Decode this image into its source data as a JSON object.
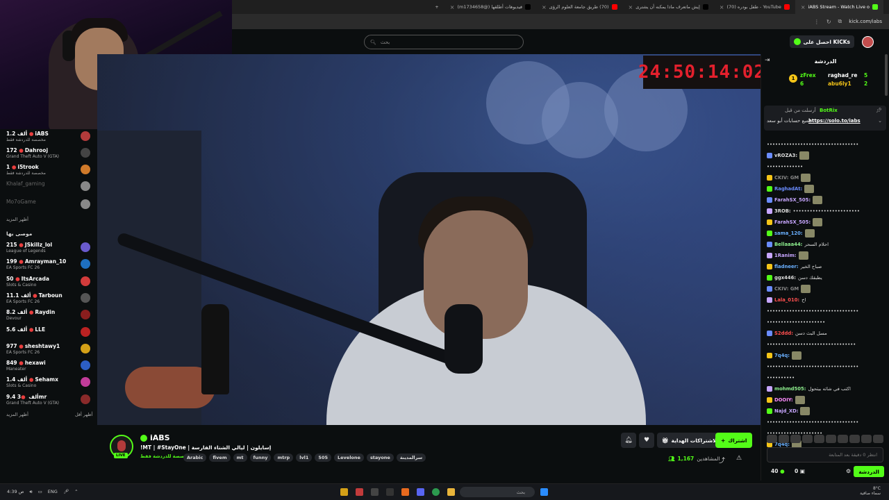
{
  "browser": {
    "tabs": [
      {
        "label": "iABS Stream - Watch Live o",
        "color": "#53fc18",
        "active": true
      },
      {
        "label": "YouTube - طفل بودره (70)",
        "color": "#ff0000",
        "active": false
      },
      {
        "label": "إيش ماتعرف ماذا يمكنه أن يشترى",
        "color": "#000000",
        "active": false
      },
      {
        "label": "(70) طريق جامعة العلوم الرؤى",
        "color": "#ff0000",
        "active": false
      },
      {
        "label": "فيديوهات أطلقها (@m1734658)",
        "color": "#000000",
        "active": false
      }
    ],
    "url": "kick.com/iabs"
  },
  "topnav": {
    "search_placeholder": "بحث",
    "get_kicks": "احصل على KICKs"
  },
  "sidebar": {
    "following": [
      {
        "name": "iABS",
        "viewers": "1.2 ألف",
        "sub": "مخصصة للدردشة فقط",
        "color": "#b23b3b"
      },
      {
        "name": "Dahrooj",
        "viewers": "172",
        "sub": "Grand Theft Auto V (GTA)",
        "color": "#444"
      },
      {
        "name": "i5trook",
        "viewers": "1",
        "sub": "مخصصة للدردشة فقط",
        "color": "#d07a2a"
      },
      {
        "name": "Khalaf_gaming",
        "viewers": "",
        "sub": "",
        "color": "#888"
      },
      {
        "name": "Mo7oGame",
        "viewers": "",
        "sub": "",
        "color": "#888"
      }
    ],
    "show_more_1": "أظهر المزيد",
    "recommended_title": "موصى بها",
    "recommended": [
      {
        "name": "JSkillz_lol",
        "viewers": "215",
        "sub": "League of Legends",
        "color": "#6a5acd"
      },
      {
        "name": "Amrayman_10",
        "viewers": "199",
        "sub": "EA Sports FC 26",
        "color": "#1e6fbf"
      },
      {
        "name": "ItsArcada",
        "viewers": "50",
        "sub": "Slots & Casino",
        "color": "#d23b3b"
      },
      {
        "name": "Tarboun",
        "viewers": "11.1 ألف",
        "sub": "EA Sports FC 26",
        "color": "#555"
      },
      {
        "name": "Raydin",
        "viewers": "8.2 ألف",
        "sub": "Devour",
        "color": "#8a1e1e"
      },
      {
        "name": "LLE",
        "viewers": "5.6 ألف",
        "sub": "",
        "color": "#b22"
      },
      {
        "name": "sheshtawy1",
        "viewers": "977",
        "sub": "EA Sports FC 26",
        "color": "#d4a017"
      },
      {
        "name": "hexawi",
        "viewers": "849",
        "sub": "Maneater",
        "color": "#2c5ec4"
      },
      {
        "name": "Sehamx",
        "viewers": "1.4 ألف",
        "sub": "Slots & Casino",
        "color": "#c23c9a"
      },
      {
        "name": "3mr",
        "viewers": "9.4 ألف",
        "sub": "Grand Theft Auto V (GTA)",
        "color": "#8a2a2a"
      }
    ],
    "show_more_2": "أظهر المزيد",
    "show_less": "أظهر أقل"
  },
  "video": {
    "timer": "24:50:14:02"
  },
  "channel": {
    "name": "iABS",
    "live": "LIVE",
    "title": "!MT | #StayOne | إسايلون | ليالي الشتاء الفارسة",
    "category": "مخصصة للدردشة فقط",
    "tags": [
      "Arabic",
      "fivem",
      "mt",
      "funny",
      "mtrp",
      "lvl1",
      "505",
      "Levelone",
      "stayone",
      "سرالمدينة"
    ],
    "follow": "اشتراك",
    "subscriptions": "الاشتراكات الهداية",
    "viewers_label": "المشاهدين",
    "viewers": "1,167"
  },
  "chat": {
    "title": "الدردشة",
    "leaderboard": [
      {
        "name": "zFrex",
        "value": "6",
        "rank": "1"
      },
      {
        "name": "raghad_re",
        "value": "5"
      },
      {
        "name": "abu6ly1",
        "value": "2"
      }
    ],
    "pinned_user": "BotRix",
    "pinned_label": "أرسلت من قبل",
    "pinned_text": "جميع حسابات أبو سعد",
    "pinned_link": "https://solo.to/iabs",
    "messages": [
      {
        "user": "",
        "text": "•••••••••••••••••••••••••••••••••",
        "color": "#ddd"
      },
      {
        "user": "vROZA3:",
        "text": "",
        "color": "#ddd"
      },
      {
        "user": "",
        "text": "•••••••••••••",
        "color": "#ddd"
      },
      {
        "user": "CKIV: GM",
        "text": "",
        "color": "#888"
      },
      {
        "user": "RaghadAt:",
        "text": "",
        "color": "#6a8cff"
      },
      {
        "user": "FarahSX_505:",
        "text": "",
        "color": "#c7a6ff"
      },
      {
        "user": "3ROB:",
        "text": "••••••••••••••••••••••••",
        "color": "#ddd"
      },
      {
        "user": "FarahSX_505:",
        "text": "",
        "color": "#c7a6ff"
      },
      {
        "user": "sama_120:",
        "text": "",
        "color": "#6ab0ff"
      },
      {
        "user": "Bellaaa44:",
        "text": "احلام السحر",
        "color": "#8ef08e"
      },
      {
        "user": "1Ranim:",
        "text": "",
        "color": "#c7a6ff"
      },
      {
        "user": "fladneer:",
        "text": "صباح الخير",
        "color": "#6ab0ff"
      },
      {
        "user": "ggx446:",
        "text": "يطبقك دسن",
        "color": "#ddd"
      },
      {
        "user": "CKIV: GM",
        "text": "",
        "color": "#888"
      },
      {
        "user": "Lala_010:",
        "text": "اخ",
        "color": "#ff4f4f"
      },
      {
        "user": "",
        "text": "•••••••••••••••••••••••••••••••••",
        "color": "#ddd"
      },
      {
        "user": "",
        "text": "•••••••••••••••••••••",
        "color": "#ddd"
      },
      {
        "user": "S2ddd:",
        "text": "مسل البث دسن",
        "color": "#ff4f4f"
      },
      {
        "user": "",
        "text": "••••••••••••••••••••••••••••••••",
        "color": "#ddd"
      },
      {
        "user": "7q4q:",
        "text": "",
        "color": "#6ab0ff"
      },
      {
        "user": "",
        "text": "•••••••••••••••••••••••••••••••••",
        "color": "#ddd"
      },
      {
        "user": "",
        "text": "••••••••••",
        "color": "#ddd"
      },
      {
        "user": "mohmd505:",
        "text": "اكتب في شاته بيتحول",
        "color": "#8ef08e"
      },
      {
        "user": "DOOIY:",
        "text": "",
        "color": "#ff8cff"
      },
      {
        "user": "Najd_XD:",
        "text": "",
        "color": "#c7a6ff"
      },
      {
        "user": "",
        "text": "•••••••••••••••••••••••••••••••••",
        "color": "#ddd"
      },
      {
        "user": "",
        "text": "••••••••••••••••••••",
        "color": "#ddd"
      },
      {
        "user": "7q4q:",
        "text": "",
        "color": "#6ab0ff"
      }
    ],
    "input_placeholder": "انتظر 0 دقيقة بعد المتابعة",
    "send": "الدردشة",
    "kicks_count": "0",
    "viewers_small": "40"
  },
  "taskbar": {
    "search_placeholder": "بحث",
    "lang": "ENG",
    "time": "4:39 ص",
    "date": "2025/10/27",
    "weather": "8°C",
    "weather_desc": "سماء صافية"
  }
}
